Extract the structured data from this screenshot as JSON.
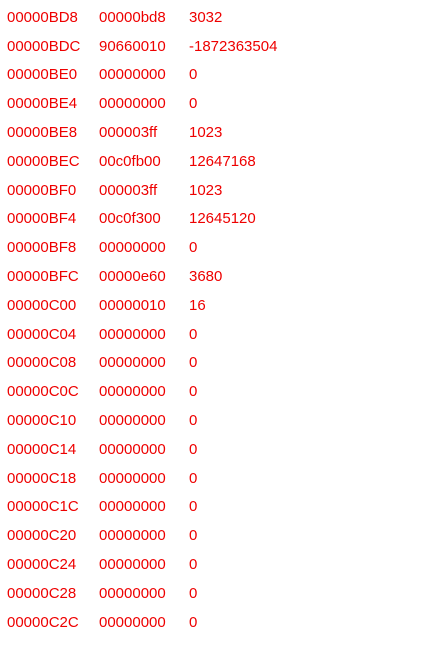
{
  "style": {
    "text_color": "#ee0000"
  },
  "rows": [
    {
      "addr": "00000BD8",
      "hex": "00000bd8",
      "dec": "3032"
    },
    {
      "addr": "00000BDC",
      "hex": "90660010",
      "dec": "-1872363504"
    },
    {
      "addr": "00000BE0",
      "hex": "00000000",
      "dec": "0"
    },
    {
      "addr": "00000BE4",
      "hex": "00000000",
      "dec": "0"
    },
    {
      "addr": "00000BE8",
      "hex": "000003ff",
      "dec": "1023"
    },
    {
      "addr": "00000BEC",
      "hex": "00c0fb00",
      "dec": "12647168"
    },
    {
      "addr": "00000BF0",
      "hex": "000003ff",
      "dec": "1023"
    },
    {
      "addr": "00000BF4",
      "hex": "00c0f300",
      "dec": "12645120"
    },
    {
      "addr": "00000BF8",
      "hex": "00000000",
      "dec": "0"
    },
    {
      "addr": "00000BFC",
      "hex": "00000e60",
      "dec": "3680"
    },
    {
      "addr": "00000C00",
      "hex": "00000010",
      "dec": "16"
    },
    {
      "addr": "00000C04",
      "hex": "00000000",
      "dec": "0"
    },
    {
      "addr": "00000C08",
      "hex": "00000000",
      "dec": "0"
    },
    {
      "addr": "00000C0C",
      "hex": "00000000",
      "dec": "0"
    },
    {
      "addr": "00000C10",
      "hex": "00000000",
      "dec": "0"
    },
    {
      "addr": "00000C14",
      "hex": "00000000",
      "dec": "0"
    },
    {
      "addr": "00000C18",
      "hex": "00000000",
      "dec": "0"
    },
    {
      "addr": "00000C1C",
      "hex": "00000000",
      "dec": "0"
    },
    {
      "addr": "00000C20",
      "hex": "00000000",
      "dec": "0"
    },
    {
      "addr": "00000C24",
      "hex": "00000000",
      "dec": "0"
    },
    {
      "addr": "00000C28",
      "hex": "00000000",
      "dec": "0"
    },
    {
      "addr": "00000C2C",
      "hex": "00000000",
      "dec": "0"
    }
  ]
}
